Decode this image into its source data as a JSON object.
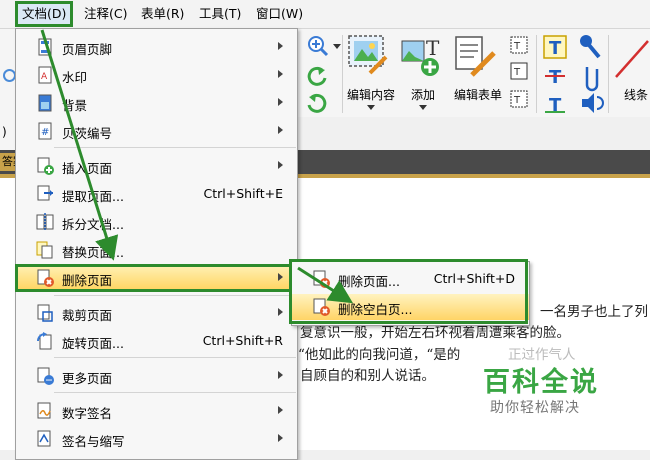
{
  "menubar": [
    {
      "label": "文档(D)",
      "active": true
    },
    {
      "label": "注释(C)",
      "active": false
    },
    {
      "label": "表单(R)",
      "active": false
    },
    {
      "label": "工具(T)",
      "active": false
    },
    {
      "label": "窗口(W)",
      "active": false
    }
  ],
  "toolbar": {
    "edit_content": "编辑内容",
    "add": "添加",
    "edit_form": "编辑表单",
    "lines": "线条"
  },
  "menu": {
    "items": [
      {
        "label": "页眉页脚",
        "shortcut": "",
        "submenu": true
      },
      {
        "label": "水印",
        "shortcut": "",
        "submenu": true
      },
      {
        "label": "背景",
        "shortcut": "",
        "submenu": true
      },
      {
        "label": "贝茨编号",
        "shortcut": "",
        "submenu": true
      },
      {
        "label": "插入页面",
        "shortcut": "",
        "submenu": true
      },
      {
        "label": "提取页面...",
        "shortcut": "Ctrl+Shift+E",
        "submenu": false
      },
      {
        "label": "拆分文档...",
        "shortcut": "",
        "submenu": false
      },
      {
        "label": "替换页面...",
        "shortcut": "",
        "submenu": false
      },
      {
        "label": "删除页面",
        "shortcut": "",
        "submenu": true
      },
      {
        "label": "裁剪页面",
        "shortcut": "",
        "submenu": true
      },
      {
        "label": "旋转页面...",
        "shortcut": "Ctrl+Shift+R",
        "submenu": false
      },
      {
        "label": "更多页面",
        "shortcut": "",
        "submenu": true
      },
      {
        "label": "数字签名",
        "shortcut": "",
        "submenu": true
      },
      {
        "label": "签名与缩写",
        "shortcut": "",
        "submenu": true
      }
    ]
  },
  "submenu": {
    "items": [
      {
        "label": "删除页面...",
        "shortcut": "Ctrl+Shift+D"
      },
      {
        "label": "删除空白页..."
      }
    ]
  },
  "doc": {
    "line1": "一名男子也上了列",
    "line2": "复意识一般，开始左右环视着周遭乘客的脸。",
    "line3": "“他如此的向我问道，“是的",
    "line3b": "正过作气人",
    "line4": "自顾自的和别人说话。"
  },
  "left_fragments": {
    "paren": ")",
    "tab": "答案"
  },
  "watermark": {
    "title": "百科全说",
    "subtitle": "助你轻松解决"
  },
  "colors": {
    "highlight_green": "#2d8b2d",
    "menu_highlight": "#ffd45e",
    "watermark_green": "#3aa644"
  }
}
